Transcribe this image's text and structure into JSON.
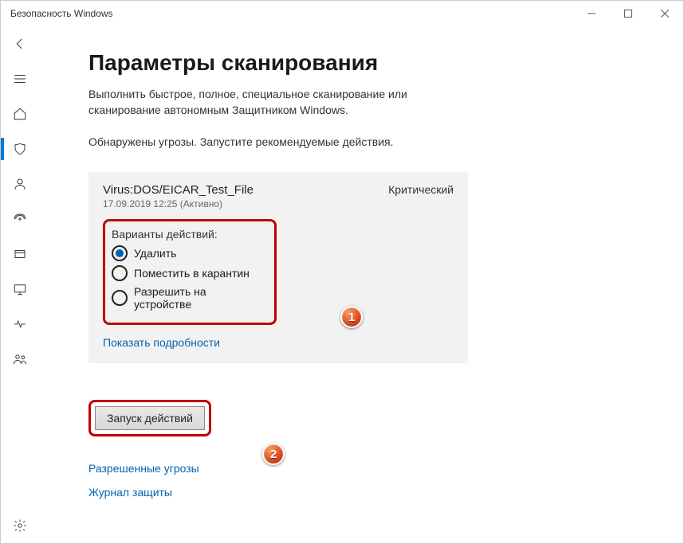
{
  "window": {
    "title": "Безопасность Windows"
  },
  "page": {
    "heading": "Параметры сканирования",
    "description": "Выполнить быстрое, полное, специальное сканирование или сканирование автономным Защитником Windows.",
    "status": "Обнаружены угрозы. Запустите рекомендуемые действия."
  },
  "threat": {
    "name": "Virus:DOS/EICAR_Test_File",
    "timestamp": "17.09.2019 12:25 (Активно)",
    "severity": "Критический",
    "options_title": "Варианты действий:",
    "options": [
      {
        "label": "Удалить",
        "selected": true
      },
      {
        "label": "Поместить в карантин",
        "selected": false
      },
      {
        "label": "Разрешить на устройстве",
        "selected": false
      }
    ],
    "details_link": "Показать подробности"
  },
  "action_button": "Запуск действий",
  "links": {
    "allowed": "Разрешенные угрозы",
    "history": "Журнал защиты"
  },
  "callouts": {
    "c1": "1",
    "c2": "2"
  }
}
